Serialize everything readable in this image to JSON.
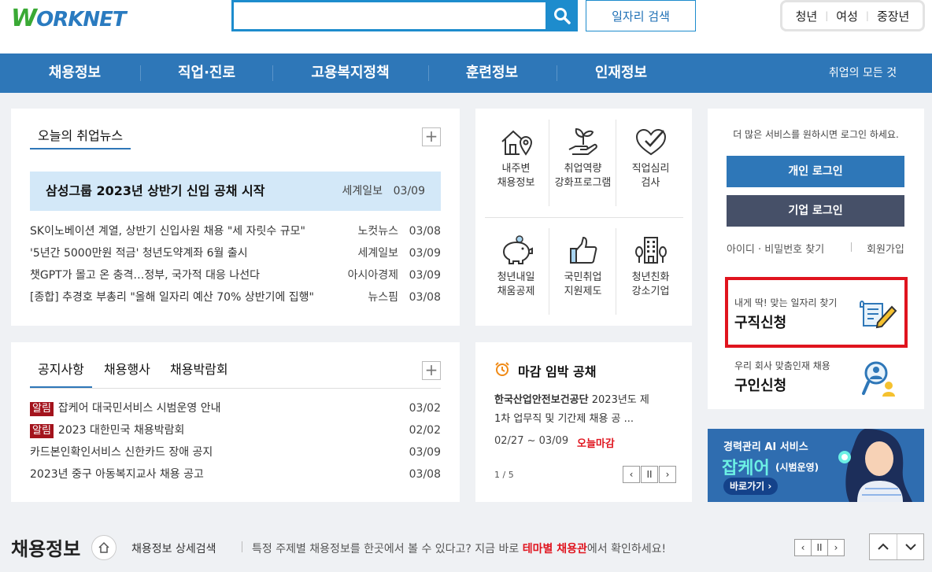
{
  "header": {
    "logo": {
      "initial": "W",
      "text": "ORKNET"
    },
    "search": {
      "value": "",
      "placeholder": ""
    },
    "job_search_label": "일자리 검색",
    "audience": [
      "청년",
      "여성",
      "중장년"
    ]
  },
  "nav": {
    "items": [
      "채용정보",
      "직업·진로",
      "고용복지정책",
      "훈련정보",
      "인재정보"
    ],
    "all_label": "취업의 모든 것"
  },
  "news": {
    "tab": "오늘의 취업뉴스",
    "headline": {
      "title": "삼성그룹 2023년 상반기 신입 공채 시작",
      "source": "세계일보",
      "date": "03/09"
    },
    "items": [
      {
        "title": "SK이노베이션 계열, 상반기 신입사원 채용 \"세 자릿수 규모\"",
        "source": "노컷뉴스",
        "date": "03/08"
      },
      {
        "title": "'5년간 5000만원 적금' 청년도약계좌 6월 출시",
        "source": "세계일보",
        "date": "03/09"
      },
      {
        "title": "챗GPT가 몰고 온 충격…정부, 국가적 대응 나선다",
        "source": "아시아경제",
        "date": "03/09"
      },
      {
        "title": "[종합] 추경호 부총리 \"올해 일자리 예산 70% 상반기에 집행\"",
        "source": "뉴스핌",
        "date": "03/08"
      }
    ]
  },
  "services": [
    {
      "line1": "내주변",
      "line2": "채용정보",
      "icon": "house-pin-icon"
    },
    {
      "line1": "취업역량",
      "line2": "강화프로그램",
      "icon": "sprout-hand-icon"
    },
    {
      "line1": "직업심리",
      "line2": "검사",
      "icon": "heart-check-icon"
    },
    {
      "line1": "청년내일",
      "line2": "채움공제",
      "icon": "piggy-bank-icon"
    },
    {
      "line1": "국민취업",
      "line2": "지원제도",
      "icon": "thumbs-up-icon"
    },
    {
      "line1": "청년친화",
      "line2": "강소기업",
      "icon": "building-icon"
    }
  ],
  "login": {
    "notice": "더 많은 서비스를 원하시면 로그인 하세요.",
    "personal_label": "개인 로그인",
    "company_label": "기업 로그인",
    "find_label": "아이디 · 비밀번호 찾기",
    "join_label": "회원가입"
  },
  "job_seek": {
    "sub": "내게 딱! 맞는 일자리 찾기",
    "title": "구직신청"
  },
  "job_offer": {
    "sub": "우리 회사 맞춤인재 채용",
    "title": "구인신청"
  },
  "notices": {
    "tabs": [
      "공지사항",
      "채용행사",
      "채용박람회"
    ],
    "items": [
      {
        "badge": "알림",
        "title": "잡케어 대국민서비스 시범운영 안내",
        "date": "03/02"
      },
      {
        "badge": "알림",
        "title": "2023 대한민국 채용박람회",
        "date": "02/02"
      },
      {
        "badge": "",
        "title": "카드본인확인서비스 신한카드 장애 공지",
        "date": "03/09"
      },
      {
        "badge": "",
        "title": "2023년 중구 아동복지교사 채용 공고",
        "date": "03/08"
      }
    ]
  },
  "deadline": {
    "title": "마감 임박 공채",
    "company": "한국산업안전보건공단",
    "desc_rest": "2023년도 제",
    "desc_line2": "1차 업무직 및 기간제 채용 공 ...",
    "period": "02/27 ~ 03/09",
    "status": "오늘마감",
    "pager": "1 / 5"
  },
  "banner": {
    "line1": "경력관리 AI 서비스",
    "brand": "잡케어",
    "tag": "(시범운영)",
    "button": "바로가기"
  },
  "bottom": {
    "title": "채용정보",
    "detail_link": "채용정보 상세검색",
    "desc_pre": "특정 주제별 채용정보를 한곳에서 볼 수 있다고? 지금 바로 ",
    "desc_emph": "테마별 채용관",
    "desc_post": "에서 확인하세요!"
  },
  "colors": {
    "primary": "#2e77b8",
    "dark": "#465068",
    "highlight_red": "#e0141e",
    "banner_bg": "#2f6db0"
  }
}
